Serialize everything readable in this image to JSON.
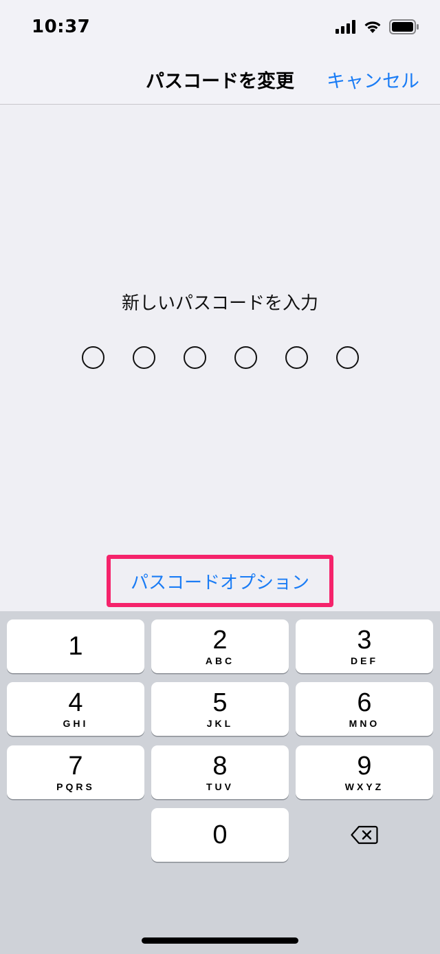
{
  "status_bar": {
    "time": "10:37",
    "icons": [
      "cellular-signal-icon",
      "wifi-icon",
      "battery-icon"
    ]
  },
  "nav": {
    "title": "パスコードを変更",
    "cancel_label": "キャンセル"
  },
  "passcode": {
    "prompt": "新しいパスコードを入力",
    "digit_count": 6,
    "entered": 0
  },
  "options_label": "パスコードオプション",
  "keypad": {
    "keys": [
      {
        "digit": "1",
        "letters": ""
      },
      {
        "digit": "2",
        "letters": "ABC"
      },
      {
        "digit": "3",
        "letters": "DEF"
      },
      {
        "digit": "4",
        "letters": "GHI"
      },
      {
        "digit": "5",
        "letters": "JKL"
      },
      {
        "digit": "6",
        "letters": "MNO"
      },
      {
        "digit": "7",
        "letters": "PQRS"
      },
      {
        "digit": "8",
        "letters": "TUV"
      },
      {
        "digit": "9",
        "letters": "WXYZ"
      },
      {
        "digit": "0",
        "letters": ""
      }
    ],
    "delete_icon": "delete-backspace-icon"
  },
  "colors": {
    "accent": "#1a7cf5",
    "highlight": "#f5236b",
    "background": "#efeff4",
    "keypad_background": "#cfd2d8"
  }
}
